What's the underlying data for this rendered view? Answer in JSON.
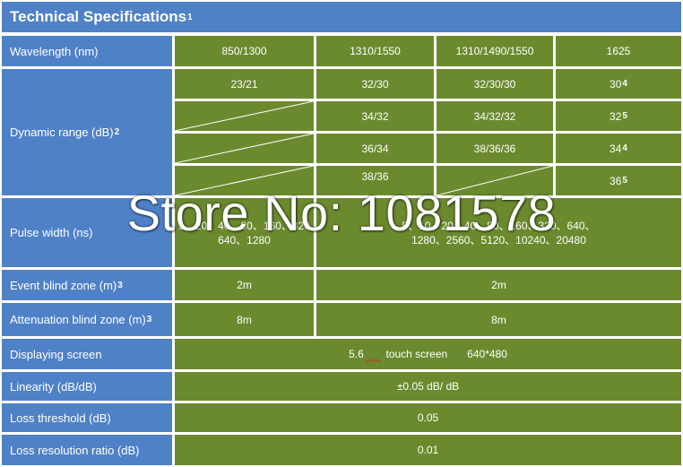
{
  "title": "Technical Specifications",
  "title_note": "1",
  "rows": {
    "wavelength": {
      "label": "Wavelength (nm)",
      "values": [
        "850/1300",
        "1310/1550",
        "1310/1490/1550",
        "1625"
      ]
    },
    "dynamic_range": {
      "label": "Dynamic range (dB)",
      "note": "2",
      "r1": [
        "23/21",
        "32/30",
        "32/30/30",
        "30"
      ],
      "r1_note": "4",
      "r2": [
        "34/32",
        "34/32/32",
        "32"
      ],
      "r2_note": "5",
      "r3": [
        "36/34",
        "38/36/36",
        "34"
      ],
      "r3_note": "4",
      "r4": [
        "38/36",
        "36"
      ],
      "r4_note": "5"
    },
    "pulse_width": {
      "label": "Pulse width (ns)",
      "v1_line1": "5、20、40、80、160、320",
      "v1_line2": "640、1280",
      "v2_line1": "5、10、20、40、80、160、320、640、",
      "v2_line2": "1280、2560、5120、10240、20480"
    },
    "event_blind": {
      "label": "Event blind zone (m)",
      "note": "3",
      "v1": "2m",
      "v2": "2m"
    },
    "atten_blind": {
      "label": "Attenuation blind zone (m)",
      "note": "3",
      "v1": "8m",
      "v2": "8m"
    },
    "display": {
      "label": "Displaying screen",
      "size": "5.6",
      "touch": "touch screen",
      "res": "640*480"
    },
    "linearity": {
      "label": "Linearity (dB/dB)",
      "value": "±0.05 dB/ dB"
    },
    "loss_threshold": {
      "label": "Loss threshold (dB)",
      "value": "0.05"
    },
    "loss_resolution": {
      "label": "Loss resolution ratio (dB)",
      "value": "0.01"
    }
  },
  "watermark": "Store No: 1081578"
}
